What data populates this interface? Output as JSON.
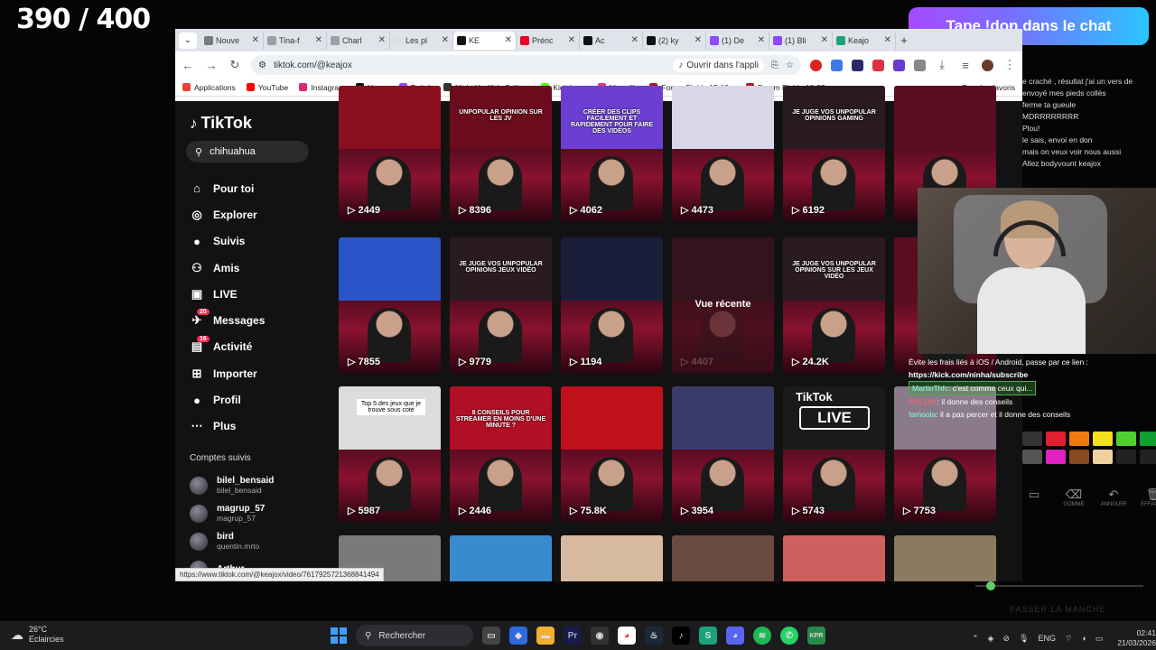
{
  "overlay": {
    "counter": "390 / 400",
    "don_banner": "Tape !don dans le chat"
  },
  "browser": {
    "tabs": [
      {
        "label": "Nouve",
        "color": "#7a7a7a"
      },
      {
        "label": "Tina-f",
        "color": "#9aa0a6"
      },
      {
        "label": "Charl",
        "color": "#9aa0a6"
      },
      {
        "label": "Les pl",
        "color": "#e0e0e0"
      },
      {
        "label": "KE",
        "color": "#111111"
      },
      {
        "label": "Prénc",
        "color": "#e60023"
      },
      {
        "label": "Ac",
        "color": "#111111"
      },
      {
        "label": "(2) ky",
        "color": "#111111"
      },
      {
        "label": "(1) De",
        "color": "#9146ff"
      },
      {
        "label": "(1) Bli",
        "color": "#9146ff"
      },
      {
        "label": "Keajo",
        "color": "#1aa37a"
      }
    ],
    "url": "tiktok.com/@keajox",
    "open_app_label": "Ouvrir dans l'appli",
    "bookmarks": [
      {
        "label": "Applications",
        "color": "#ea4335"
      },
      {
        "label": "YouTube",
        "color": "#ff0000"
      },
      {
        "label": "Instagram",
        "color": "#d62976"
      },
      {
        "label": "Home",
        "color": "#111111"
      },
      {
        "label": "Twitch",
        "color": "#9146ff"
      },
      {
        "label": "NinhaYeslife's Splitg...",
        "color": "#333333"
      },
      {
        "label": "Kick Logo",
        "color": "#53fc18"
      },
      {
        "label": "Ninouille",
        "color": "#e8356d"
      },
      {
        "label": "Forum Blabla 15-18...",
        "color": "#b01b1b"
      },
      {
        "label": "Forum Blabla 18-25...",
        "color": "#b01b1b"
      }
    ],
    "all_bookmarks_label": "Tous les favoris",
    "status_url": "https://www.tiktok.com/@keajox/video/7617925721368841494"
  },
  "tiktok": {
    "logo": "TikTok",
    "search_value": "chihuahua",
    "menu": [
      {
        "label": "Pour toi",
        "icon": "home-icon",
        "glyph": "⌂"
      },
      {
        "label": "Explorer",
        "icon": "compass-icon",
        "glyph": "◎"
      },
      {
        "label": "Suivis",
        "icon": "following-icon",
        "glyph": "●"
      },
      {
        "label": "Amis",
        "icon": "friends-icon",
        "glyph": "⚇"
      },
      {
        "label": "LIVE",
        "icon": "live-icon",
        "glyph": "▣"
      },
      {
        "label": "Messages",
        "icon": "messages-icon",
        "glyph": "✈",
        "badge": "20"
      },
      {
        "label": "Activité",
        "icon": "activity-icon",
        "glyph": "▤",
        "badge": "16"
      },
      {
        "label": "Importer",
        "icon": "upload-icon",
        "glyph": "⊞"
      },
      {
        "label": "Profil",
        "icon": "profile-icon",
        "glyph": "●"
      },
      {
        "label": "Plus",
        "icon": "more-icon",
        "glyph": "⋯"
      }
    ],
    "following_title": "Comptes suivis",
    "following": [
      {
        "name": "bilel_bensaid",
        "handle": "bilel_bensaid"
      },
      {
        "name": "magrup_57",
        "handle": "magrup_57"
      },
      {
        "name": "bird",
        "handle": "quentin.mrto"
      },
      {
        "name": "Arthur",
        "handle": ""
      }
    ],
    "videos": [
      {
        "views": "2449",
        "caption": "",
        "top": "#8a0f1f"
      },
      {
        "views": "8396",
        "caption": "Unpopular opinion sur les JV",
        "top": "#6a0c1c"
      },
      {
        "views": "4062",
        "caption": "Créer des clips facilement et rapidement pour faire des vidéos",
        "top": "#6b3fd1"
      },
      {
        "views": "4473",
        "caption": "",
        "top": "#d7d7e8"
      },
      {
        "views": "6192",
        "caption": "Je juge vos unpopular opinions gaming",
        "top": "#2a1a22"
      },
      {
        "views": "",
        "caption": "",
        "top": "#5a0c22"
      },
      {
        "views": "7855",
        "caption": "",
        "top": "#2a55c8"
      },
      {
        "views": "9779",
        "caption": "Je juge vos unpopular opinions jeux vidéo",
        "top": "#2a1a22"
      },
      {
        "views": "1194",
        "caption": "",
        "top": "#1a1e3a"
      },
      {
        "views": "4407",
        "caption": "",
        "top": "#222222",
        "recent": "Vue récente"
      },
      {
        "views": "24.2K",
        "caption": "Je juge vos unpopular opinions sur les jeux vidéo",
        "top": "#2a1a22"
      },
      {
        "views": "",
        "caption": "",
        "top": "#5a0c22"
      },
      {
        "views": "5987",
        "caption": "",
        "top": "#dcdcdc",
        "top5": "Top 5 des jeux que je trouve sous coté"
      },
      {
        "views": "2446",
        "caption": "8 conseils pour streamer en moins d'une minute ?",
        "top": "#b00f25"
      },
      {
        "views": "75.8K",
        "caption": "",
        "top": "#c0101c"
      },
      {
        "views": "3954",
        "caption": "",
        "top": "#3a3a6a"
      },
      {
        "views": "5743",
        "caption": "",
        "top": "#1a1a1a",
        "live": "LIVE",
        "live_tag": "TikTok"
      },
      {
        "views": "7753",
        "caption": "",
        "top": "#8a7a8a"
      },
      {
        "views": "",
        "caption": "",
        "top": "#7a7a7a"
      },
      {
        "views": "",
        "caption": "",
        "top": "#3a8ad0"
      },
      {
        "views": "",
        "caption": "",
        "top": "#d7b9a0"
      },
      {
        "views": "",
        "caption": "",
        "top": "#6a4a40"
      },
      {
        "views": "",
        "caption": "",
        "top": "#d06060"
      },
      {
        "views": "",
        "caption": "",
        "top": "#8a7a60"
      }
    ]
  },
  "chat_top": [
    "e craché , résultat j'ai un vers de",
    "envoyé mes pieds collés",
    "ferme ta gueule",
    "MDRRRRRRRR",
    "Plou!",
    "le sais, envoi en don",
    "mais on veux voir nous aussi",
    "Allez bodyvount keajox"
  ],
  "chat_bottom": {
    "line1": "Évite les frais liés à iOS / Android, passe par ce lien :",
    "link": "https://kick.com/ninha/subscribe",
    "line2_user": "MartinThfc",
    "line2": ": c'est comme ceux qui...",
    "line3_user": "PRL10K",
    "line3": ": il donne des conseils",
    "line4_user": "famoola",
    "line4": ": il a pas percer et il donne des conseils"
  },
  "palette": [
    "#333333",
    "#e02030",
    "#f07a10",
    "#f5e020",
    "#50d030",
    "#10a030",
    "#555555",
    "#e020c0",
    "#8a4a20",
    "#f0d0a0",
    "#222222",
    "#222222"
  ],
  "tools": [
    {
      "label": "",
      "glyph": "▭"
    },
    {
      "label": "GOMME",
      "glyph": "⌫"
    },
    {
      "label": "ANNULER",
      "glyph": "↶"
    },
    {
      "label": "EFFACER",
      "glyph": "🗑"
    }
  ],
  "passer_label": "PASSER LA MANCHE",
  "taskbar": {
    "temp": "26°C",
    "weather": "Eclaircies",
    "search": "Rechercher",
    "lang": "ENG",
    "time": "02:41",
    "date": "21/03/2026"
  }
}
